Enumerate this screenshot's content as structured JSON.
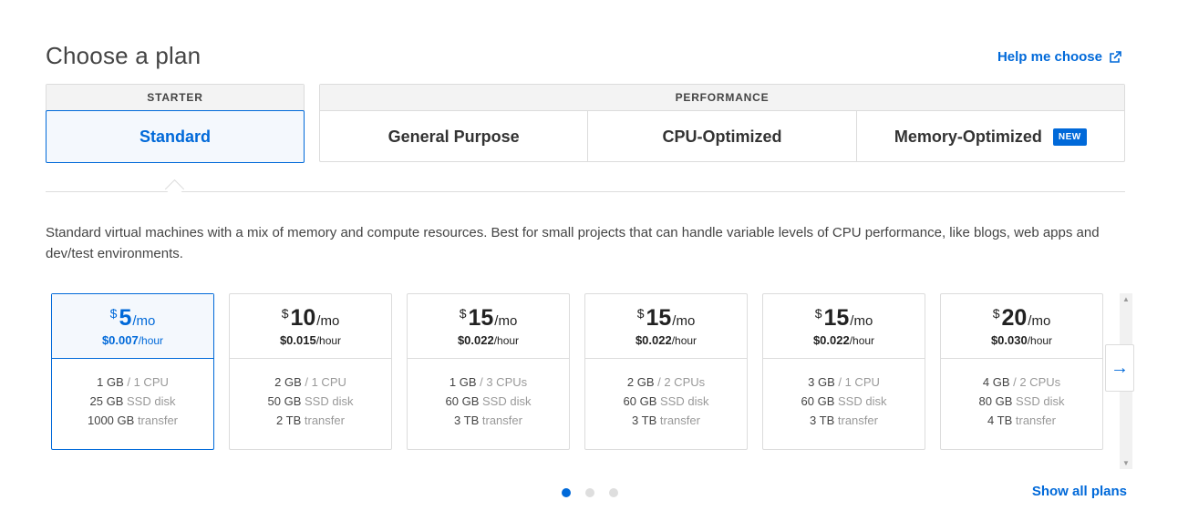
{
  "title": "Choose a plan",
  "help_link": "Help me choose",
  "groups": {
    "starter": {
      "label": "STARTER",
      "tabs": [
        "Standard"
      ]
    },
    "performance": {
      "label": "PERFORMANCE",
      "tabs": [
        "General Purpose",
        "CPU-Optimized",
        "Memory-Optimized"
      ],
      "new_badge": "NEW"
    }
  },
  "description": "Standard virtual machines with a mix of memory and compute resources. Best for small projects that can handle variable levels of CPU performance, like blogs, web apps and dev/test environments.",
  "plans": [
    {
      "currency": "$",
      "amount": "5",
      "per": "/mo",
      "hourly": "$0.007",
      "hourly_unit": "/hour",
      "ram": "1 GB",
      "cpu": "/ 1 CPU",
      "disk": "25 GB",
      "disk_label": "SSD disk",
      "transfer": "1000 GB",
      "transfer_label": "transfer"
    },
    {
      "currency": "$",
      "amount": "10",
      "per": "/mo",
      "hourly": "$0.015",
      "hourly_unit": "/hour",
      "ram": "2 GB",
      "cpu": "/ 1 CPU",
      "disk": "50 GB",
      "disk_label": "SSD disk",
      "transfer": "2 TB",
      "transfer_label": "transfer"
    },
    {
      "currency": "$",
      "amount": "15",
      "per": "/mo",
      "hourly": "$0.022",
      "hourly_unit": "/hour",
      "ram": "1 GB",
      "cpu": "/ 3 CPUs",
      "disk": "60 GB",
      "disk_label": "SSD disk",
      "transfer": "3 TB",
      "transfer_label": "transfer"
    },
    {
      "currency": "$",
      "amount": "15",
      "per": "/mo",
      "hourly": "$0.022",
      "hourly_unit": "/hour",
      "ram": "2 GB",
      "cpu": "/ 2 CPUs",
      "disk": "60 GB",
      "disk_label": "SSD disk",
      "transfer": "3 TB",
      "transfer_label": "transfer"
    },
    {
      "currency": "$",
      "amount": "15",
      "per": "/mo",
      "hourly": "$0.022",
      "hourly_unit": "/hour",
      "ram": "3 GB",
      "cpu": "/ 1 CPU",
      "disk": "60 GB",
      "disk_label": "SSD disk",
      "transfer": "3 TB",
      "transfer_label": "transfer"
    },
    {
      "currency": "$",
      "amount": "20",
      "per": "/mo",
      "hourly": "$0.030",
      "hourly_unit": "/hour",
      "ram": "4 GB",
      "cpu": "/ 2 CPUs",
      "disk": "80 GB",
      "disk_label": "SSD disk",
      "transfer": "4 TB",
      "transfer_label": "transfer"
    }
  ],
  "next_icon": "arrow-right",
  "show_all": "Show all plans",
  "colors": {
    "accent": "#0069d9",
    "border": "#dcdcdc",
    "selected_bg": "#f4f8fd"
  }
}
